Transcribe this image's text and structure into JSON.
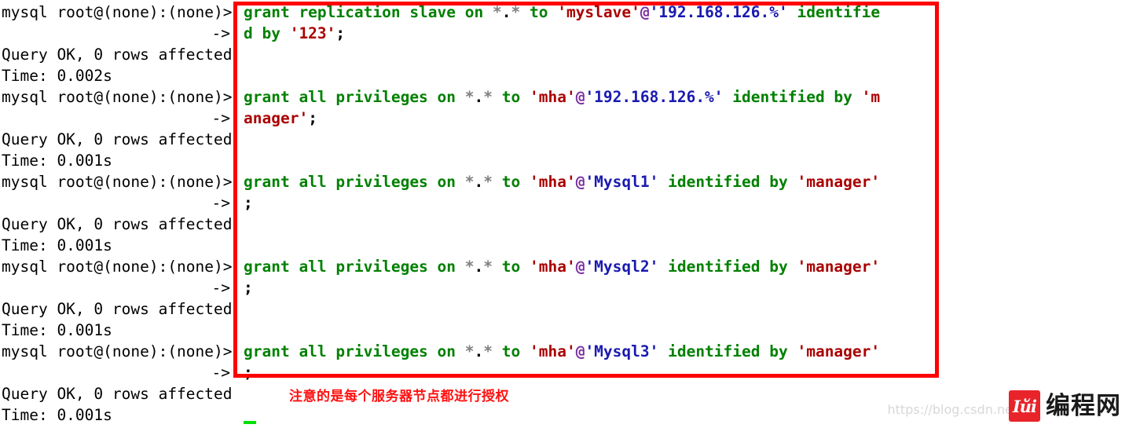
{
  "terminal": {
    "prompt": "mysql root@(none):(none)>",
    "continuation": "->",
    "result_ok": "Query OK, 0 rows affected",
    "lines": [
      {
        "type": "prompt",
        "prompt": "mysql root@(none):(none)>"
      },
      {
        "type": "cont",
        "prompt": "->"
      },
      {
        "type": "out",
        "prompt": "Query OK, 0 rows affected"
      },
      {
        "type": "out",
        "prompt": "Time: 0.002s"
      },
      {
        "type": "prompt",
        "prompt": "mysql root@(none):(none)>"
      },
      {
        "type": "cont",
        "prompt": "->"
      },
      {
        "type": "out",
        "prompt": "Query OK, 0 rows affected"
      },
      {
        "type": "out",
        "prompt": "Time: 0.001s"
      },
      {
        "type": "prompt",
        "prompt": "mysql root@(none):(none)>"
      },
      {
        "type": "cont",
        "prompt": "->"
      },
      {
        "type": "out",
        "prompt": "Query OK, 0 rows affected"
      },
      {
        "type": "out",
        "prompt": "Time: 0.001s"
      },
      {
        "type": "prompt",
        "prompt": "mysql root@(none):(none)>"
      },
      {
        "type": "cont",
        "prompt": "->"
      },
      {
        "type": "out",
        "prompt": "Query OK, 0 rows affected"
      },
      {
        "type": "out",
        "prompt": "Time: 0.001s"
      },
      {
        "type": "prompt",
        "prompt": "mysql root@(none):(none)>"
      },
      {
        "type": "cont",
        "prompt": "->"
      },
      {
        "type": "out",
        "prompt": "Query OK, 0 rows affected"
      },
      {
        "type": "out",
        "prompt": "Time: 0.001s"
      }
    ],
    "times": [
      "0.002s",
      "0.001s",
      "0.001s",
      "0.001s",
      "0.001s"
    ],
    "commands": [
      {
        "id": "grant-replication-slave",
        "row1": [
          {
            "t": "grant replication slave on ",
            "c": "kw"
          },
          {
            "t": "*",
            "c": "star"
          },
          {
            "t": ".",
            "c": "dot"
          },
          {
            "t": "*",
            "c": "star"
          },
          {
            "t": " to ",
            "c": "kw"
          },
          {
            "t": "'myslave'",
            "c": "str"
          },
          {
            "t": "@",
            "c": "at"
          },
          {
            "t": "'192.168.126.%'",
            "c": "host"
          },
          {
            "t": " identifie",
            "c": "kw"
          }
        ],
        "row2": [
          {
            "t": "d by ",
            "c": "kw"
          },
          {
            "t": "'123'",
            "c": "str"
          },
          {
            "t": ";",
            "c": "punc"
          }
        ]
      },
      {
        "id": "grant-all-mha-subnet",
        "row1": [
          {
            "t": "grant all privileges on ",
            "c": "kw"
          },
          {
            "t": "*",
            "c": "star"
          },
          {
            "t": ".",
            "c": "dot"
          },
          {
            "t": "*",
            "c": "star"
          },
          {
            "t": " to ",
            "c": "kw"
          },
          {
            "t": "'mha'",
            "c": "str"
          },
          {
            "t": "@",
            "c": "at"
          },
          {
            "t": "'192.168.126.%'",
            "c": "host"
          },
          {
            "t": " identified by ",
            "c": "kw"
          },
          {
            "t": "'m",
            "c": "str"
          }
        ],
        "row2": [
          {
            "t": "anager'",
            "c": "str"
          },
          {
            "t": ";",
            "c": "punc"
          }
        ]
      },
      {
        "id": "grant-all-mha-mysql1",
        "row1": [
          {
            "t": "grant all privileges on ",
            "c": "kw"
          },
          {
            "t": "*",
            "c": "star"
          },
          {
            "t": ".",
            "c": "dot"
          },
          {
            "t": "*",
            "c": "star"
          },
          {
            "t": " to ",
            "c": "kw"
          },
          {
            "t": "'mha'",
            "c": "str"
          },
          {
            "t": "@",
            "c": "at"
          },
          {
            "t": "'Mysql1'",
            "c": "host"
          },
          {
            "t": " identified by ",
            "c": "kw"
          },
          {
            "t": "'manager'",
            "c": "str"
          }
        ],
        "row2": [
          {
            "t": ";",
            "c": "punc"
          }
        ]
      },
      {
        "id": "grant-all-mha-mysql2",
        "row1": [
          {
            "t": "grant all privileges on ",
            "c": "kw"
          },
          {
            "t": "*",
            "c": "star"
          },
          {
            "t": ".",
            "c": "dot"
          },
          {
            "t": "*",
            "c": "star"
          },
          {
            "t": " to ",
            "c": "kw"
          },
          {
            "t": "'mha'",
            "c": "str"
          },
          {
            "t": "@",
            "c": "at"
          },
          {
            "t": "'Mysql2'",
            "c": "host"
          },
          {
            "t": " identified by ",
            "c": "kw"
          },
          {
            "t": "'manager'",
            "c": "str"
          }
        ],
        "row2": [
          {
            "t": ";",
            "c": "punc"
          }
        ]
      },
      {
        "id": "grant-all-mha-mysql3",
        "row1": [
          {
            "t": "grant all privileges on ",
            "c": "kw"
          },
          {
            "t": "*",
            "c": "star"
          },
          {
            "t": ".",
            "c": "dot"
          },
          {
            "t": "*",
            "c": "star"
          },
          {
            "t": " to ",
            "c": "kw"
          },
          {
            "t": "'mha'",
            "c": "str"
          },
          {
            "t": "@",
            "c": "at"
          },
          {
            "t": "'Mysql3'",
            "c": "host"
          },
          {
            "t": " identified by ",
            "c": "kw"
          },
          {
            "t": "'manager'",
            "c": "str"
          }
        ],
        "row2": [
          {
            "t": ";",
            "c": "punc"
          }
        ]
      }
    ]
  },
  "annotation": {
    "text": "注意的是每个服务器节点都进行授权",
    "color": "#ff1010"
  },
  "highlight": {
    "color": "#ff0000"
  },
  "cursor": {
    "color": "#00e000"
  },
  "watermark": {
    "url": "https://blog.csdn.ne",
    "logo_glyph": "Iйi",
    "brand": "编程网",
    "logo_color": "#e8242a"
  }
}
